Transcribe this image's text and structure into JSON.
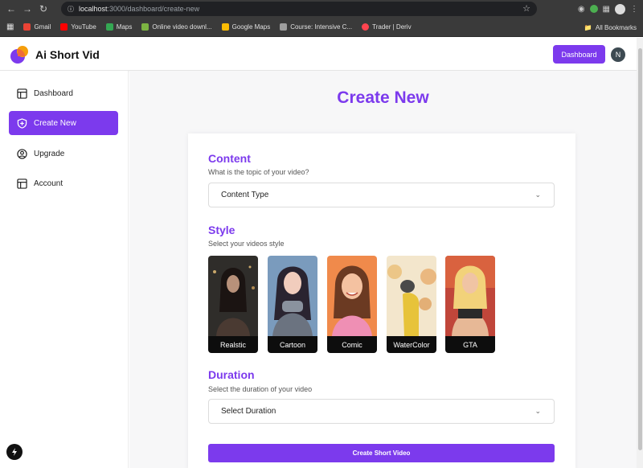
{
  "browser": {
    "url_host": "localhost",
    "url_path": ":3000/dashboard/create-new",
    "bookmarks": [
      {
        "label": "Gmail",
        "color": "#ea4335"
      },
      {
        "label": "YouTube",
        "color": "#ff0000"
      },
      {
        "label": "Maps",
        "color": "#34a853"
      },
      {
        "label": "Online video downl...",
        "color": "#7cb342"
      },
      {
        "label": "Google Maps",
        "color": "#fbbc04"
      },
      {
        "label": "Course: Intensive C...",
        "color": "#9e9e9e"
      },
      {
        "label": "Trader | Deriv",
        "color": "#ff444f"
      }
    ],
    "all_bookmarks": "All Bookmarks"
  },
  "header": {
    "app_title": "Ai Short Vid",
    "dashboard_button": "Dashboard",
    "avatar_initial": "N",
    "accent": "#7c3aed"
  },
  "sidebar": {
    "items": [
      {
        "label": "Dashboard",
        "icon": "layout-icon",
        "active": false
      },
      {
        "label": "Create New",
        "icon": "shield-plus-icon",
        "active": true
      },
      {
        "label": "Upgrade",
        "icon": "user-circle-icon",
        "active": false
      },
      {
        "label": "Account",
        "icon": "layout-icon",
        "active": false
      }
    ]
  },
  "main": {
    "page_title": "Create New",
    "content": {
      "title": "Content",
      "subtitle": "What is the topic of your video?",
      "select_value": "Content Type"
    },
    "style": {
      "title": "Style",
      "subtitle": "Select your videos style",
      "options": [
        {
          "label": "Realstic",
          "bg": "#3b3a36"
        },
        {
          "label": "Cartoon",
          "bg": "#5a7fa3"
        },
        {
          "label": "Comic",
          "bg": "#e9884a"
        },
        {
          "label": "WaterColor",
          "bg": "#e3c58f"
        },
        {
          "label": "GTA",
          "bg": "#c94a3a"
        }
      ]
    },
    "duration": {
      "title": "Duration",
      "subtitle": "Select the duration of your video",
      "select_value": "Select Duration"
    },
    "create_button": "Create Short Video"
  },
  "floating_badge": "N"
}
